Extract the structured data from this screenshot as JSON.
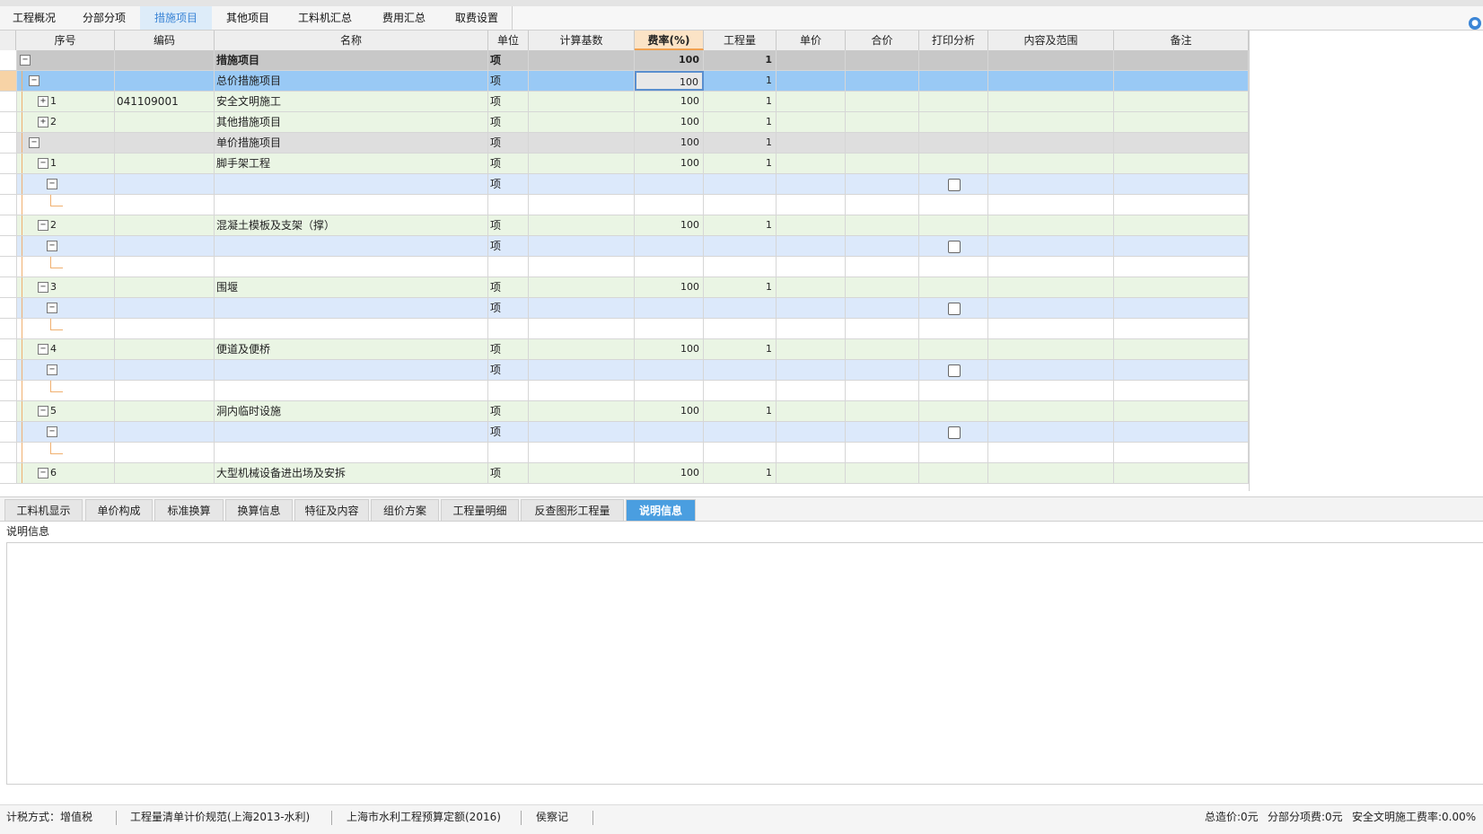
{
  "top_tabs": [
    "工程概况",
    "分部分项",
    "措施项目",
    "其他项目",
    "工料机汇总",
    "费用汇总",
    "取费设置"
  ],
  "top_active_tab": "措施项目",
  "columns": [
    "序号",
    "编码",
    "名称",
    "单位",
    "计算基数",
    "费率(%)",
    "工程量",
    "单价",
    "合价",
    "打印分析",
    "内容及范围",
    "备注"
  ],
  "rows": [
    {
      "seq": "",
      "code": "",
      "name": "措施项目",
      "unit": "项",
      "rate": "100",
      "qty": "1",
      "kind": "root"
    },
    {
      "seq": "",
      "code": "",
      "name": "总价措施项目",
      "unit": "项",
      "rate": "100",
      "qty": "1",
      "kind": "selected"
    },
    {
      "seq": "1",
      "code": "041109001",
      "name": "安全文明施工",
      "unit": "项",
      "rate": "100",
      "qty": "1",
      "kind": "item"
    },
    {
      "seq": "2",
      "code": "",
      "name": "其他措施项目",
      "unit": "项",
      "rate": "100",
      "qty": "1",
      "kind": "item"
    },
    {
      "seq": "",
      "code": "",
      "name": "单价措施项目",
      "unit": "项",
      "rate": "100",
      "qty": "1",
      "kind": "group"
    },
    {
      "seq": "1",
      "code": "",
      "name": "脚手架工程",
      "unit": "项",
      "rate": "100",
      "qty": "1",
      "kind": "item"
    },
    {
      "seq": "",
      "code": "",
      "name": "",
      "unit": "项",
      "rate": "",
      "qty": "",
      "kind": "sub"
    },
    {
      "seq": "",
      "code": "",
      "name": "",
      "unit": "",
      "rate": "",
      "qty": "",
      "kind": "blank"
    },
    {
      "seq": "2",
      "code": "",
      "name": "混凝土模板及支架（撑）",
      "unit": "项",
      "rate": "100",
      "qty": "1",
      "kind": "item"
    },
    {
      "seq": "",
      "code": "",
      "name": "",
      "unit": "项",
      "rate": "",
      "qty": "",
      "kind": "sub"
    },
    {
      "seq": "",
      "code": "",
      "name": "",
      "unit": "",
      "rate": "",
      "qty": "",
      "kind": "blank"
    },
    {
      "seq": "3",
      "code": "",
      "name": "围堰",
      "unit": "项",
      "rate": "100",
      "qty": "1",
      "kind": "item"
    },
    {
      "seq": "",
      "code": "",
      "name": "",
      "unit": "项",
      "rate": "",
      "qty": "",
      "kind": "sub"
    },
    {
      "seq": "",
      "code": "",
      "name": "",
      "unit": "",
      "rate": "",
      "qty": "",
      "kind": "blank"
    },
    {
      "seq": "4",
      "code": "",
      "name": "便道及便桥",
      "unit": "项",
      "rate": "100",
      "qty": "1",
      "kind": "item"
    },
    {
      "seq": "",
      "code": "",
      "name": "",
      "unit": "项",
      "rate": "",
      "qty": "",
      "kind": "sub"
    },
    {
      "seq": "",
      "code": "",
      "name": "",
      "unit": "",
      "rate": "",
      "qty": "",
      "kind": "blank"
    },
    {
      "seq": "5",
      "code": "",
      "name": "洞内临时设施",
      "unit": "项",
      "rate": "100",
      "qty": "1",
      "kind": "item"
    },
    {
      "seq": "",
      "code": "",
      "name": "",
      "unit": "项",
      "rate": "",
      "qty": "",
      "kind": "sub"
    },
    {
      "seq": "",
      "code": "",
      "name": "",
      "unit": "",
      "rate": "",
      "qty": "",
      "kind": "blank"
    },
    {
      "seq": "6",
      "code": "",
      "name": "大型机械设备进出场及安拆",
      "unit": "项",
      "rate": "100",
      "qty": "1",
      "kind": "item"
    }
  ],
  "bottom_tabs": [
    "工料机显示",
    "单价构成",
    "标准换算",
    "换算信息",
    "特征及内容",
    "组价方案",
    "工程量明细",
    "反查图形工程量",
    "说明信息"
  ],
  "bottom_active_tab": "说明信息",
  "description_label": "说明信息",
  "status": {
    "tax_mode": "计税方式：增值税",
    "spec": "工程量清单计价规范(上海2013-水利)",
    "quota": "上海市水利工程预算定额(2016)",
    "author": "侯察记",
    "total_cost": "总造价:0元",
    "sub_cost": "分部分项费:0元",
    "safety_rate": "安全文明施工费率:0.00%"
  },
  "colors": {
    "selected_row": "#99c9f5",
    "item_row": "#eaf5e4",
    "sub_row": "#dce9fb",
    "root_row": "#c8c8c8",
    "group_row": "#dedede",
    "active_tab": "#4a9ee0"
  }
}
